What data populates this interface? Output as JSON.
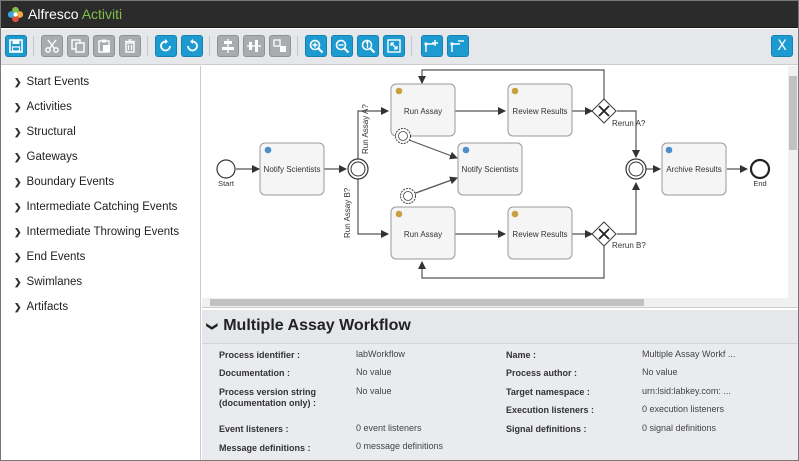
{
  "app": {
    "brand_part1": "Alfresco",
    "brand_part2": "Activiti",
    "logo_icon": "alfresco-flower-logo"
  },
  "toolbar": {
    "close_label": "X",
    "groups": [
      [
        "save-icon"
      ],
      [
        "cut-icon",
        "copy-icon",
        "paste-icon",
        "delete-icon"
      ],
      [
        "redo-icon",
        "undo-icon"
      ],
      [
        "align-horizontal-icon",
        "align-vertical-icon",
        "same-size-icon"
      ],
      [
        "zoom-in-icon",
        "zoom-out-icon",
        "zoom-actual-icon",
        "zoom-fit-icon"
      ],
      [
        "bend-point-add-icon",
        "bend-point-remove-icon"
      ]
    ]
  },
  "sidebar": {
    "items": [
      {
        "label": "Start Events"
      },
      {
        "label": "Activities"
      },
      {
        "label": "Structural"
      },
      {
        "label": "Gateways"
      },
      {
        "label": "Boundary Events"
      },
      {
        "label": "Intermediate Catching Events"
      },
      {
        "label": "Intermediate Throwing Events"
      },
      {
        "label": "End Events"
      },
      {
        "label": "Swimlanes"
      },
      {
        "label": "Artifacts"
      }
    ]
  },
  "diagram": {
    "start_label": "Start",
    "end_label": "End",
    "task_notify_1": "Notify Scientists",
    "task_run_a": "Run Assay",
    "task_review_a": "Review Results",
    "task_notify_2": "Notify Scientists",
    "task_run_b": "Run Assay",
    "task_review_b": "Review Results",
    "task_archive": "Archive Results",
    "flow_run_a": "Run Assay A?",
    "flow_run_b": "Run Assay B?",
    "flow_rerun_a": "Rerun A?",
    "flow_rerun_b": "Rerun B?"
  },
  "properties": {
    "title": "Multiple Assay Workflow",
    "left": [
      {
        "label": "Process identifier :",
        "value": "labWorkflow"
      },
      {
        "label": "Documentation :",
        "value": "No value"
      },
      {
        "label": "Process version string (documentation only) :",
        "value": "No value"
      },
      {
        "label": "Event listeners :",
        "value": "0 event listeners"
      },
      {
        "label": "Message definitions :",
        "value": "0 message definitions"
      }
    ],
    "right": [
      {
        "label": "Name :",
        "value": "Multiple Assay Workf ..."
      },
      {
        "label": "Process author :",
        "value": "No value"
      },
      {
        "label": "Target namespace :",
        "value": "urn:lsid:labkey.com: ..."
      },
      {
        "label": "Execution listeners :",
        "value": "0 execution listeners"
      },
      {
        "label": "Signal definitions :",
        "value": "0 signal definitions"
      }
    ]
  }
}
